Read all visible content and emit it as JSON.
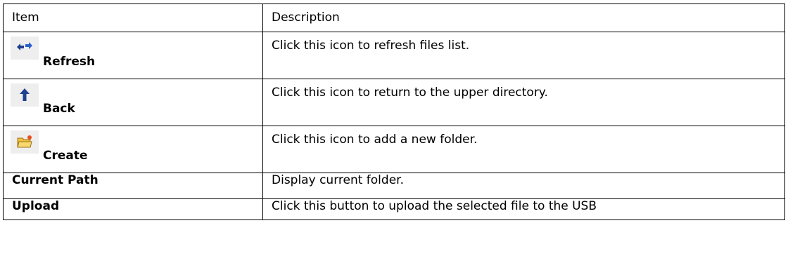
{
  "table": {
    "headers": {
      "item": "Item",
      "description": "Description"
    },
    "rows": [
      {
        "item": "Refresh",
        "icon": "refresh-arrows-icon",
        "description": "Click this icon to refresh files list."
      },
      {
        "item": "Back",
        "icon": "up-arrow-icon",
        "description": "Click this icon to return to the upper directory."
      },
      {
        "item": "Create",
        "icon": "new-folder-icon",
        "description": "Click this icon to add a new folder."
      },
      {
        "item": "Current Path",
        "description": "Display current folder."
      },
      {
        "item": "Upload",
        "description": "Click this button to upload the selected file to the USB"
      }
    ]
  },
  "colors": {
    "border": "#000000",
    "icon_background": "#eeeeee",
    "arrow_blue": "#1f3f8f",
    "folder_yellow": "#f0c040",
    "folder_star": "#e85020"
  }
}
